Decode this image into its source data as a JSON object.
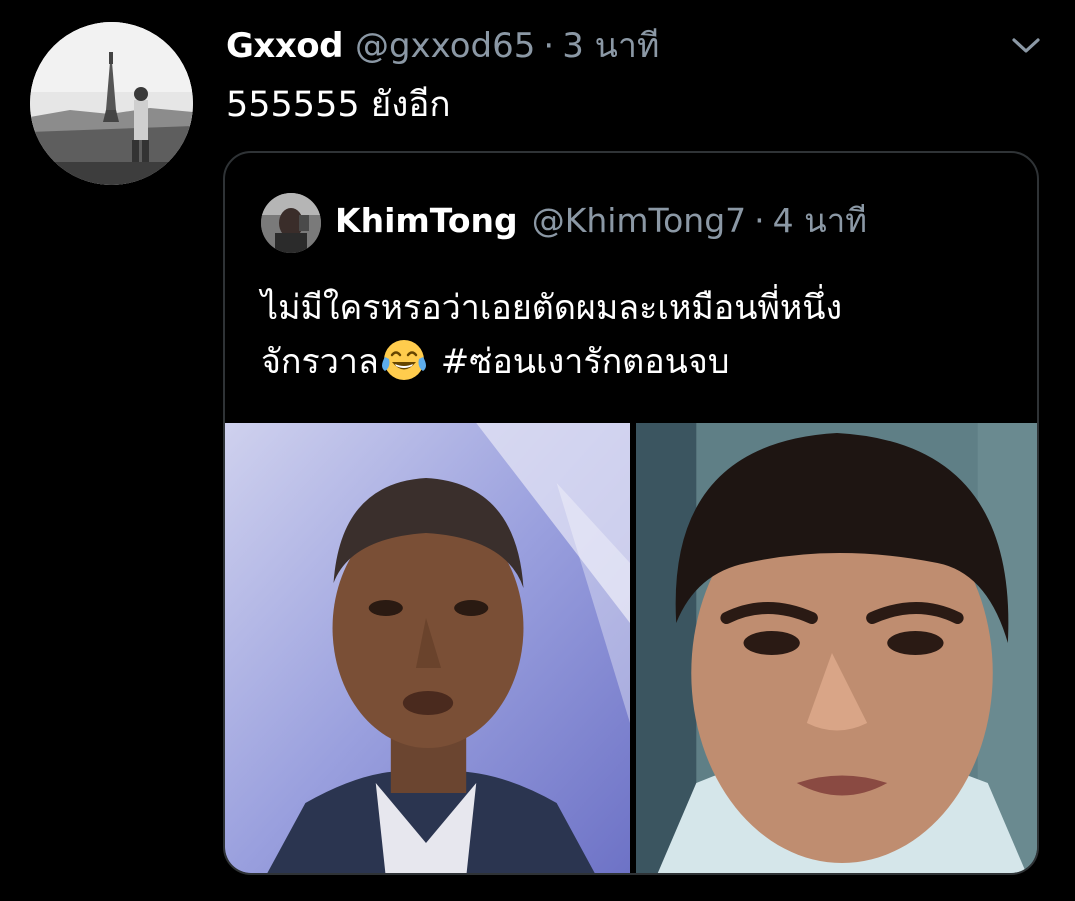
{
  "tweet": {
    "display_name": "Gxxod",
    "handle": "@gxxod65",
    "separator": "·",
    "time": "3 นาที",
    "text": "555555 ยังอีก",
    "avatar_icon": "profile-photo-eiffel-tower",
    "menu_icon": "chevron-down-icon"
  },
  "quoted_tweet": {
    "display_name": "KhimTong",
    "handle": "@KhimTong7",
    "separator": "·",
    "time": "4 นาที",
    "text_line1": "ไม่มีใครหรอว่าเอยตัดผมละเหมือนพี่หนึ่ง",
    "text_line2": "จักรวาล",
    "emoji": "face-with-tears-of-joy",
    "hashtag": "#ซ่อนเงารักตอนจบ",
    "media": [
      {
        "name": "photo-man-short-hair",
        "alt": ""
      },
      {
        "name": "photo-woman-short-hair",
        "alt": ""
      }
    ]
  },
  "colors": {
    "background": "#000000",
    "text_primary": "#ffffff",
    "text_secondary": "#8b98a5",
    "card_border": "#2f3336"
  }
}
